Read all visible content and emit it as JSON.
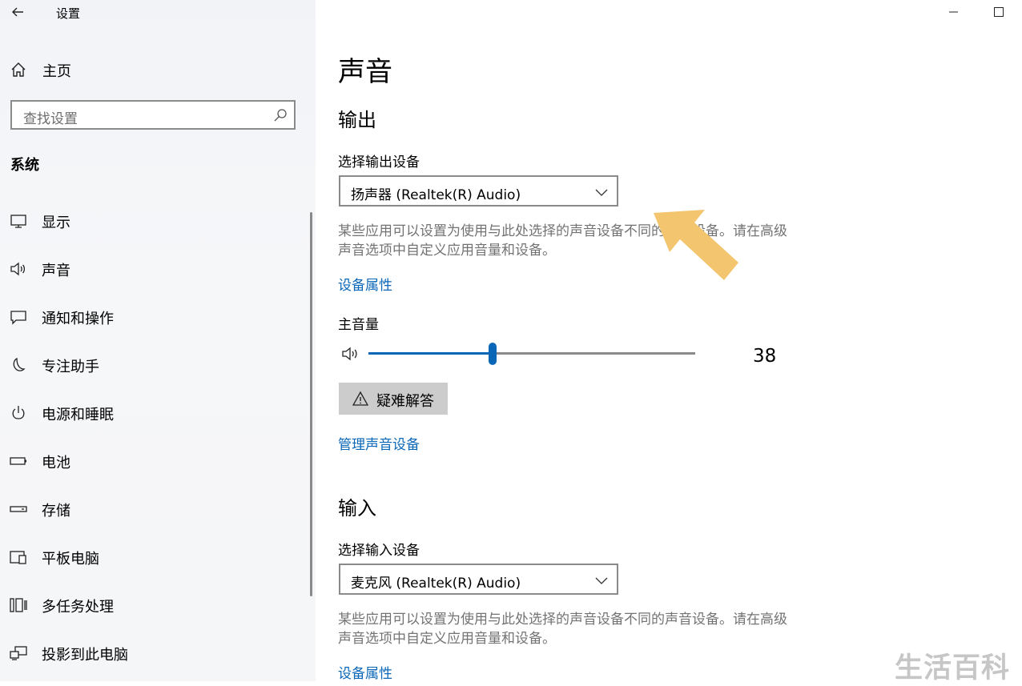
{
  "window": {
    "title": "设置"
  },
  "sidebar": {
    "home_label": "主页",
    "search_placeholder": "查找设置",
    "section": "系统",
    "items": [
      {
        "label": "显示",
        "icon": "monitor-icon"
      },
      {
        "label": "声音",
        "icon": "speaker-icon"
      },
      {
        "label": "通知和操作",
        "icon": "notification-icon"
      },
      {
        "label": "专注助手",
        "icon": "moon-icon"
      },
      {
        "label": "电源和睡眠",
        "icon": "power-icon"
      },
      {
        "label": "电池",
        "icon": "battery-icon"
      },
      {
        "label": "存储",
        "icon": "storage-icon"
      },
      {
        "label": "平板电脑",
        "icon": "tablet-icon"
      },
      {
        "label": "多任务处理",
        "icon": "multitasking-icon"
      },
      {
        "label": "投影到此电脑",
        "icon": "projecting-icon"
      }
    ]
  },
  "main": {
    "title": "声音",
    "output": {
      "heading": "输出",
      "select_label": "选择输出设备",
      "device": "扬声器 (Realtek(R) Audio)",
      "desc": "某些应用可以设置为使用与此处选择的声音设备不同的声音设备。请在高级声音选项中自定义应用音量和设备。",
      "properties_link": "设备属性",
      "volume_label": "主音量",
      "volume_value": "38",
      "volume_fraction": 0.38,
      "troubleshoot_label": "疑难解答",
      "manage_link": "管理声音设备"
    },
    "input": {
      "heading": "输入",
      "select_label": "选择输入设备",
      "device": "麦克风 (Realtek(R) Audio)",
      "desc": "某些应用可以设置为使用与此处选择的声音设备不同的声音设备。请在高级声音选项中自定义应用音量和设备。",
      "properties_link": "设备属性"
    }
  },
  "watermark": "生活百科",
  "colors": {
    "accent": "#0a67b8",
    "annotation_arrow": "#f3c56e"
  }
}
